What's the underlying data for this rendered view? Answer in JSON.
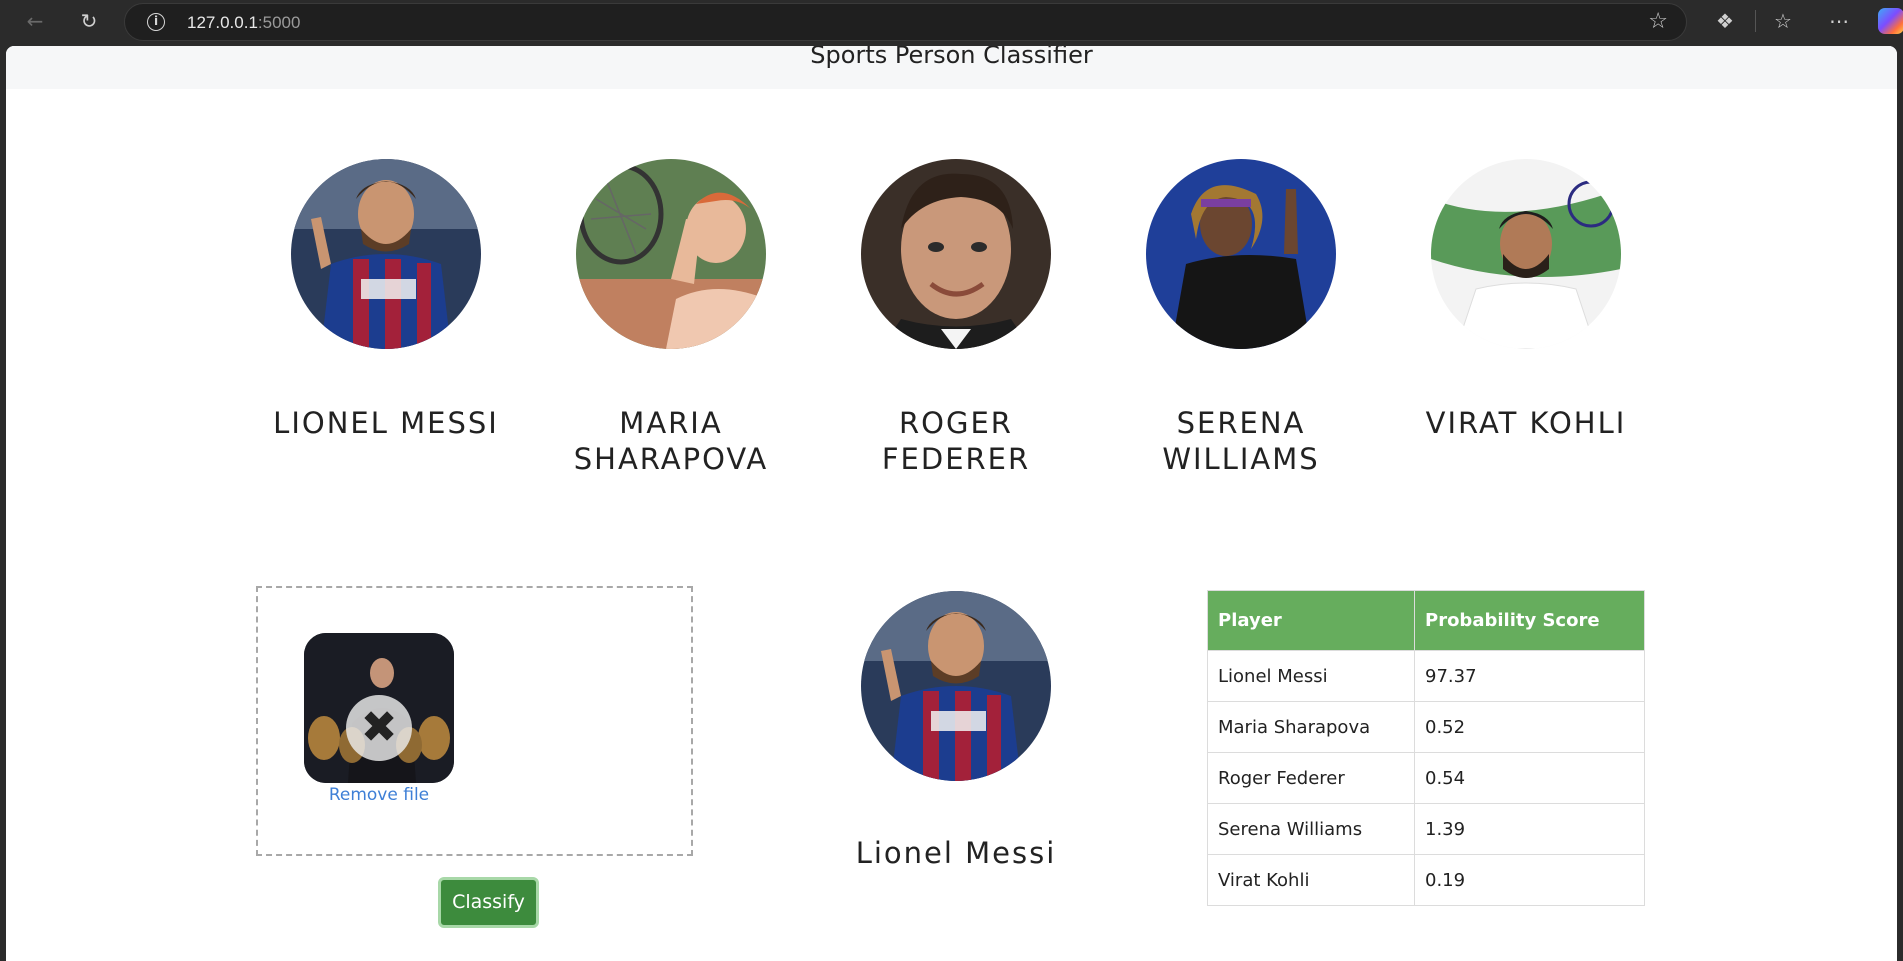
{
  "browser": {
    "url_host": "127.0.0.1",
    "url_port": ":5000"
  },
  "header": {
    "title": "Sports Person Classifier"
  },
  "players": [
    {
      "name": "Lionel Messi"
    },
    {
      "name": "Maria Sharapova"
    },
    {
      "name": "Roger Federer"
    },
    {
      "name": "Serena Williams"
    },
    {
      "name": "Virat Kohli"
    }
  ],
  "upload": {
    "remove_label": "Remove file",
    "classify_label": "Classify"
  },
  "result": {
    "name": "Lionel Messi"
  },
  "table": {
    "headers": [
      "Player",
      "Probability Score"
    ],
    "rows": [
      [
        "Lionel Messi",
        "97.37"
      ],
      [
        "Maria Sharapova",
        "0.52"
      ],
      [
        "Roger Federer",
        "0.54"
      ],
      [
        "Serena Williams",
        "1.39"
      ],
      [
        "Virat Kohli",
        "0.19"
      ]
    ]
  },
  "colors": {
    "table_header": "#66ad5d",
    "button": "#3d8b3d",
    "link": "#3e7fd6"
  }
}
